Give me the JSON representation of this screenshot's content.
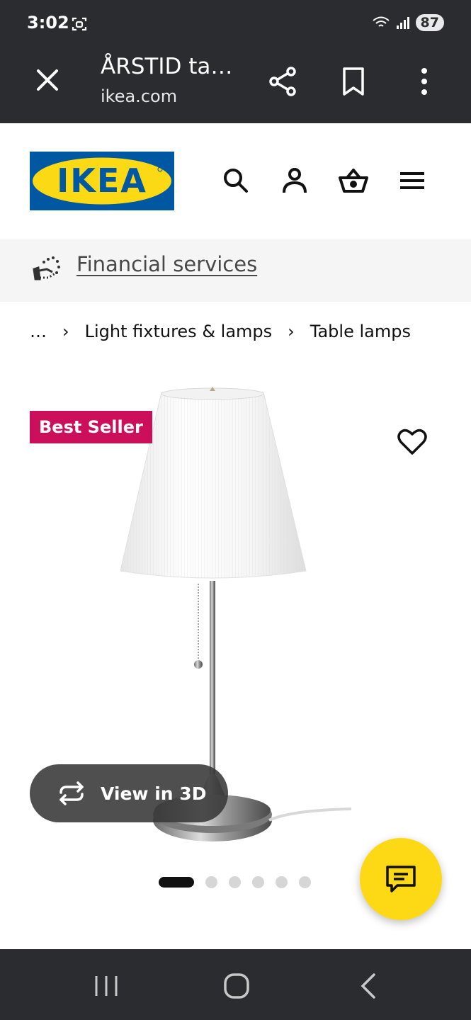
{
  "status_bar": {
    "time": "3:02",
    "battery": "87",
    "icons": [
      "screen-capture-icon",
      "wifi-icon",
      "signal-icon",
      "battery-icon"
    ]
  },
  "browser": {
    "tab_title": "ÅRSTID ta…",
    "url": "ikea.com",
    "icons": [
      "close-icon",
      "share-icon",
      "bookmark-icon",
      "more-vert-icon"
    ]
  },
  "header": {
    "logo_text": "IKEA",
    "icons": [
      "search-icon",
      "account-icon",
      "basket-icon",
      "menu-icon"
    ]
  },
  "financial": {
    "link": "Financial services",
    "icon": "financial-services-icon"
  },
  "breadcrumb": {
    "items": [
      "…",
      "Light fixtures & lamps",
      "Table lamps"
    ],
    "separator": "›"
  },
  "product": {
    "badge": "Best Seller",
    "view3d_label": "View in 3D",
    "carousel": {
      "count": 6,
      "active_index": 0
    }
  },
  "colors": {
    "ikea_blue": "#0058a3",
    "ikea_yellow": "#fbd914",
    "badge_pink": "#cc0f5b",
    "chat_yellow": "#fdd915",
    "system_bar": "#2b2c2f"
  }
}
